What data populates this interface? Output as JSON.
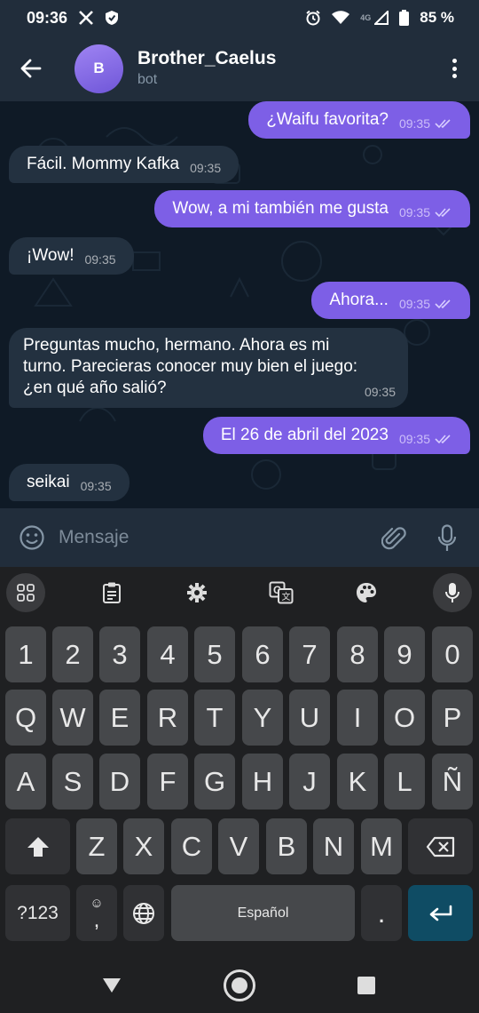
{
  "status_bar": {
    "time": "09:36",
    "network": "4G",
    "battery": "85 %"
  },
  "header": {
    "avatar_letter": "B",
    "title": "Brother_Caelus",
    "subtitle": "bot"
  },
  "messages": [
    {
      "dir": "out",
      "text": "¿Waifu favorita?",
      "time": "09:35",
      "read": true
    },
    {
      "dir": "in",
      "text": "Fácil. Mommy Kafka",
      "time": "09:35"
    },
    {
      "dir": "out",
      "text": "Wow, a mi también me gusta",
      "time": "09:35",
      "read": true
    },
    {
      "dir": "in",
      "text": "¡Wow!",
      "time": "09:35"
    },
    {
      "dir": "out",
      "text": "Ahora...",
      "time": "09:35",
      "read": true
    },
    {
      "dir": "in",
      "lines": [
        "Preguntas mucho, hermano. Ahora es mi",
        "turno. Parecieras conocer muy bien el juego:",
        "¿en qué año salió?"
      ],
      "time": "09:35"
    },
    {
      "dir": "out",
      "text": "El 26 de abril del 2023",
      "time": "09:35",
      "read": true
    },
    {
      "dir": "in",
      "text": "seikai",
      "time": "09:35"
    }
  ],
  "composer": {
    "placeholder": "Mensaje"
  },
  "keyboard": {
    "number_row": [
      "1",
      "2",
      "3",
      "4",
      "5",
      "6",
      "7",
      "8",
      "9",
      "0"
    ],
    "row1": [
      "Q",
      "W",
      "E",
      "R",
      "T",
      "Y",
      "U",
      "I",
      "O",
      "P"
    ],
    "row2": [
      "A",
      "S",
      "D",
      "F",
      "G",
      "H",
      "J",
      "K",
      "L",
      "Ñ"
    ],
    "row3": [
      "Z",
      "X",
      "C",
      "V",
      "B",
      "N",
      "M"
    ],
    "symbols_label": "?123",
    "emoji_key_label": "☺",
    "comma_label": ",",
    "space_label": "Español",
    "period_label": "."
  },
  "colors": {
    "outgoing_bubble": "#7d5fe6",
    "incoming_bubble": "#233140",
    "header_bg": "#212d3b",
    "enter_key": "#0f4c64"
  }
}
